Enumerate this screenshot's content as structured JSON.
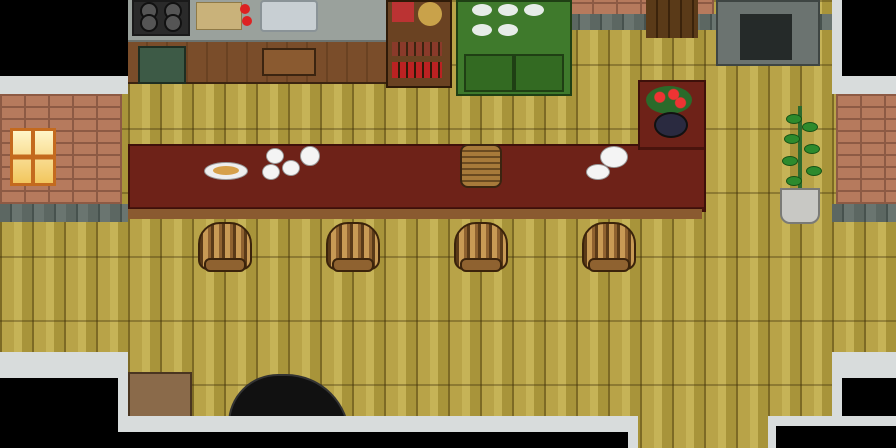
{
  "scene": {
    "type": "rpg-interior-kitchen",
    "colors": {
      "floor": "#b8a348",
      "brick": "#b67a5d",
      "bar_table": "#6e2218",
      "hutch": "#3f7a2c",
      "void": "#000000"
    },
    "objects": [
      "stove-icon",
      "sink-icon",
      "cutting-board-icon",
      "kitchen-shelf-icon",
      "green-hutch-icon",
      "fireplace-icon",
      "flower-vase-icon",
      "potted-plant-icon",
      "bar-table-icon",
      "plate-of-bread-icon",
      "teacups-icon",
      "teapot-icon",
      "basket-icon",
      "bar-stool-icon",
      "window-icon",
      "grand-piano-icon",
      "door-mat-icon"
    ],
    "bar_stool_count": 4
  }
}
